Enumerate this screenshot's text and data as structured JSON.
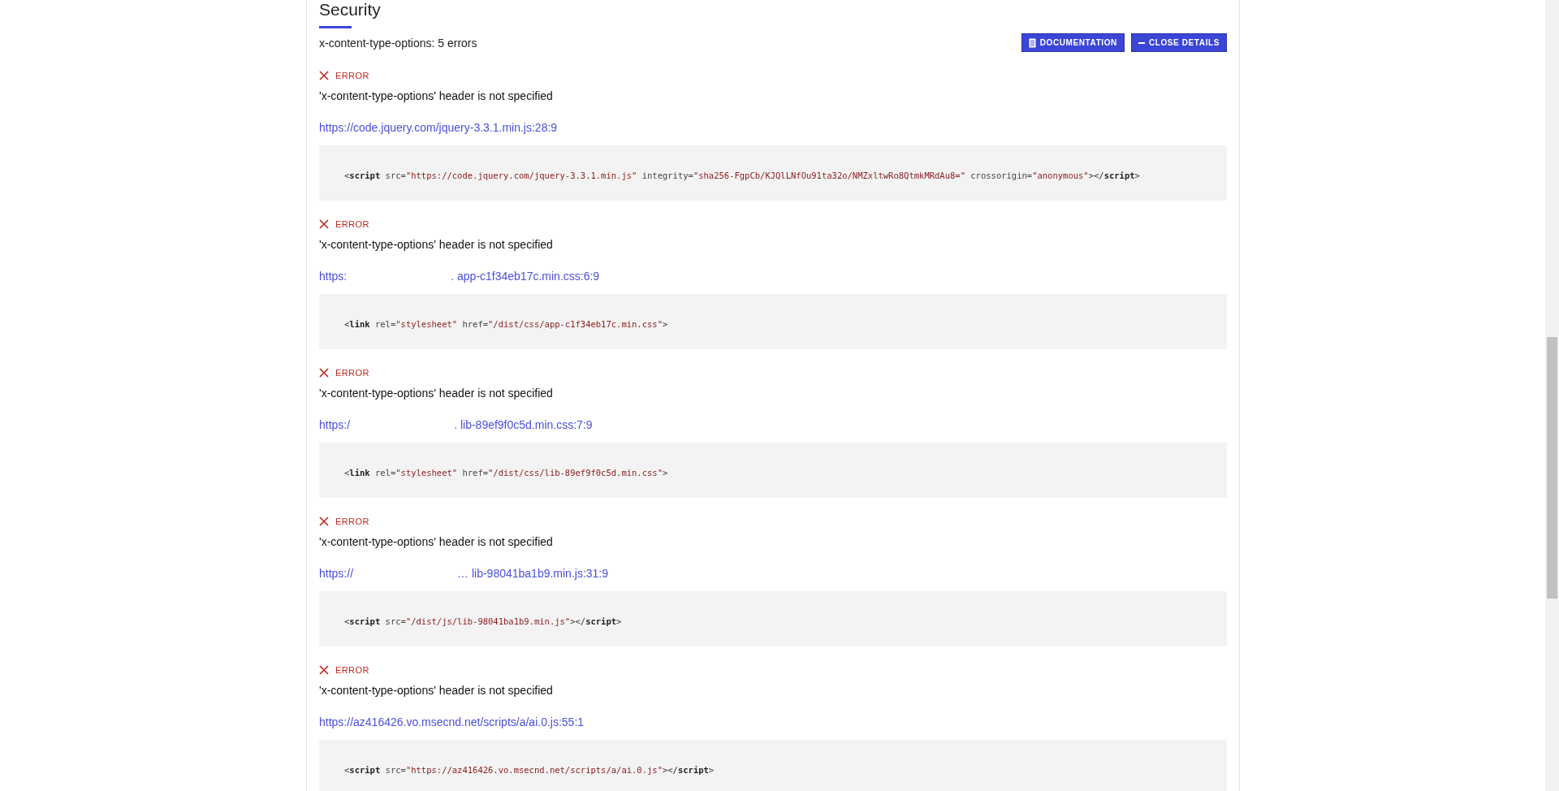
{
  "section": {
    "title": "Security"
  },
  "summary": "x-content-type-options: 5 errors",
  "buttons": [
    {
      "kind": "doc",
      "label": "DOCUMENTATION"
    },
    {
      "kind": "close",
      "label": "CLOSE DETAILS"
    }
  ],
  "errors": [
    {
      "level": "ERROR",
      "message": "'x-content-type-options' header is not specified",
      "link": {
        "parts": [
          "https://code.jquery.com/jquery-3.3.1.min.js:28:9"
        ]
      },
      "code": [
        {
          "kind": "punct",
          "text": "<"
        },
        {
          "kind": "tag",
          "text": "script"
        },
        {
          "kind": "attr",
          "text": " src="
        },
        {
          "kind": "value",
          "text": "\"https://code.jquery.com/jquery-3.3.1.min.js\""
        },
        {
          "kind": "attr",
          "text": " integrity="
        },
        {
          "kind": "value",
          "text": "\"sha256-FgpCb/KJQlLNfOu91ta32o/NMZxltwRo8QtmkMRdAu8=\""
        },
        {
          "kind": "attr",
          "text": " crossorigin="
        },
        {
          "kind": "value",
          "text": "\"anonymous\""
        },
        {
          "kind": "punct",
          "text": "></"
        },
        {
          "kind": "tag",
          "text": "script"
        },
        {
          "kind": "punct",
          "text": ">"
        }
      ]
    },
    {
      "level": "ERROR",
      "message": "'x-content-type-options' header is not specified",
      "link": {
        "parts": [
          "https:",
          ". app-c1f34eb17c.min.css:6:9"
        ]
      },
      "code": [
        {
          "kind": "punct",
          "text": "<"
        },
        {
          "kind": "tag",
          "text": "link"
        },
        {
          "kind": "attr",
          "text": " rel="
        },
        {
          "kind": "value",
          "text": "\"stylesheet\""
        },
        {
          "kind": "attr",
          "text": " href="
        },
        {
          "kind": "value",
          "text": "\"/dist/css/app-c1f34eb17c.min.css\""
        },
        {
          "kind": "punct",
          "text": ">"
        }
      ]
    },
    {
      "level": "ERROR",
      "message": "'x-content-type-options' header is not specified",
      "link": {
        "parts": [
          "https:/",
          ". lib-89ef9f0c5d.min.css:7:9"
        ]
      },
      "code": [
        {
          "kind": "punct",
          "text": "<"
        },
        {
          "kind": "tag",
          "text": "link"
        },
        {
          "kind": "attr",
          "text": " rel="
        },
        {
          "kind": "value",
          "text": "\"stylesheet\""
        },
        {
          "kind": "attr",
          "text": " href="
        },
        {
          "kind": "value",
          "text": "\"/dist/css/lib-89ef9f0c5d.min.css\""
        },
        {
          "kind": "punct",
          "text": ">"
        }
      ]
    },
    {
      "level": "ERROR",
      "message": "'x-content-type-options' header is not specified",
      "link": {
        "parts": [
          "https://",
          "… lib-98041ba1b9.min.js:31:9"
        ]
      },
      "code": [
        {
          "kind": "punct",
          "text": "<"
        },
        {
          "kind": "tag",
          "text": "script"
        },
        {
          "kind": "attr",
          "text": " src="
        },
        {
          "kind": "value",
          "text": "\"/dist/js/lib-98041ba1b9.min.js\""
        },
        {
          "kind": "punct",
          "text": "></"
        },
        {
          "kind": "tag",
          "text": "script"
        },
        {
          "kind": "punct",
          "text": ">"
        }
      ]
    },
    {
      "level": "ERROR",
      "message": "'x-content-type-options' header is not specified",
      "link": {
        "parts": [
          "https://az416426.vo.msecnd.net/scripts/a/ai.0.js:55:1"
        ]
      },
      "code": [
        {
          "kind": "punct",
          "text": "<"
        },
        {
          "kind": "tag",
          "text": "script"
        },
        {
          "kind": "attr",
          "text": " src="
        },
        {
          "kind": "value",
          "text": "\"https://az416426.vo.msecnd.net/scripts/a/ai.0.js\""
        },
        {
          "kind": "punct",
          "text": "></"
        },
        {
          "kind": "tag",
          "text": "script"
        },
        {
          "kind": "punct",
          "text": ">"
        }
      ]
    }
  ]
}
